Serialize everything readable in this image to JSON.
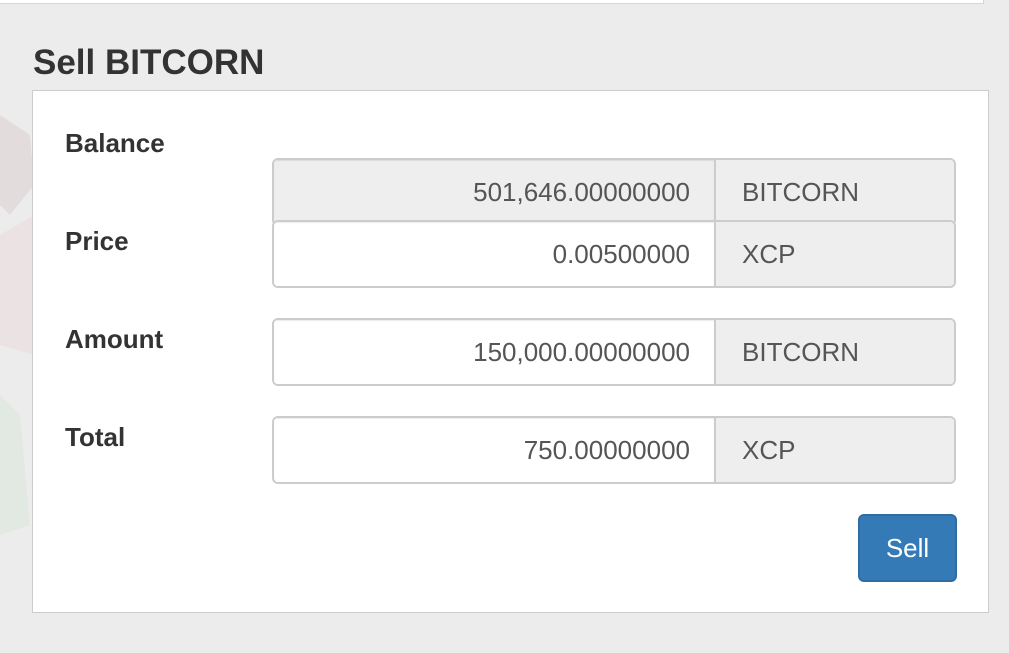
{
  "form": {
    "title": "Sell BITCORN",
    "rows": [
      {
        "label": "Balance",
        "value": "501,646.00000000",
        "unit": "BITCORN",
        "readonly": true
      },
      {
        "label": "Price",
        "value": "0.00500000",
        "unit": "XCP",
        "readonly": false
      },
      {
        "label": "Amount",
        "value": "150,000.00000000",
        "unit": "BITCORN",
        "readonly": false
      },
      {
        "label": "Total",
        "value": "750.00000000",
        "unit": "XCP",
        "readonly": false
      }
    ],
    "submit_label": "Sell"
  },
  "colors": {
    "page_bg": "#ececec",
    "panel_bg": "#ffffff",
    "readonly_bg": "#eeeeee",
    "addon_bg": "#eeeeee",
    "button_bg": "#337ab7",
    "button_text": "#ffffff",
    "label_text": "#333333",
    "field_text": "#555555"
  }
}
